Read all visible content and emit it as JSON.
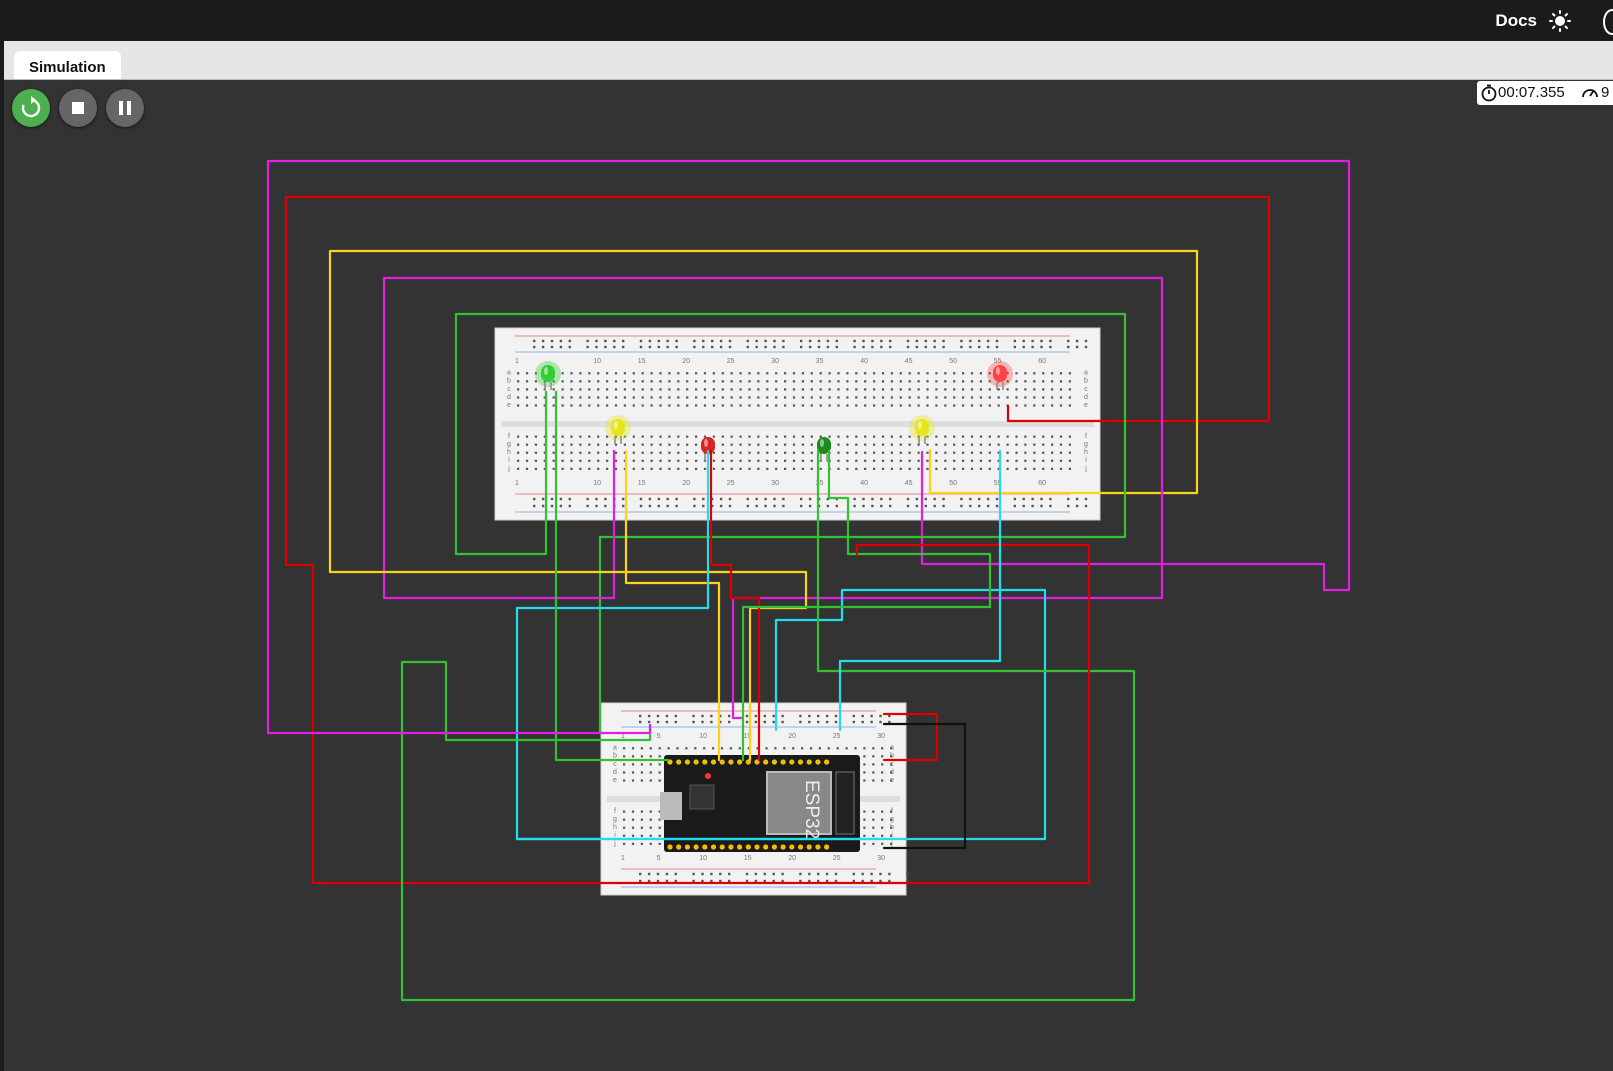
{
  "header": {
    "docs_label": "Docs",
    "theme_icon": "sun-icon"
  },
  "tabs": [
    {
      "label": "Simulation",
      "active": true
    }
  ],
  "toolbar": {
    "restart_icon": "restart-icon",
    "stop_icon": "stop-icon",
    "pause_icon": "pause-icon",
    "restart_color": "#4caf50",
    "button_color": "#666666"
  },
  "status": {
    "clock_icon": "stopwatch-icon",
    "elapsed_time": "00:07.355",
    "speed_icon": "speedometer-icon",
    "speed_value": "9"
  },
  "circuit": {
    "main_breadboard": {
      "column_numbers": [
        "1",
        "10",
        "15",
        "20",
        "25",
        "30",
        "35",
        "40",
        "45",
        "50",
        "55",
        "60"
      ],
      "row_letters_top": [
        "a",
        "b",
        "c",
        "d",
        "e"
      ],
      "row_letters_bottom": [
        "f",
        "g",
        "h",
        "i",
        "j"
      ]
    },
    "small_breadboard": {
      "column_numbers": [
        "1",
        "5",
        "10",
        "15",
        "20",
        "25",
        "30"
      ],
      "row_letters_top": [
        "a",
        "b",
        "c",
        "d",
        "e"
      ],
      "row_letters_bottom": [
        "f",
        "g",
        "h",
        "i",
        "j"
      ]
    },
    "microcontroller_label": "ESP32",
    "leds": [
      {
        "name": "led-green-1",
        "color": "#33cc33",
        "lit": true
      },
      {
        "name": "led-yellow-1",
        "color": "#e6e61a",
        "lit": true
      },
      {
        "name": "led-red-1",
        "color": "#dd2222",
        "lit": false
      },
      {
        "name": "led-green-2",
        "color": "#1f8a1f",
        "lit": false
      },
      {
        "name": "led-yellow-2",
        "color": "#e6e61a",
        "lit": true
      },
      {
        "name": "led-red-2",
        "color": "#ff4444",
        "lit": true
      }
    ],
    "wire_colors": {
      "magenta": "#e020e0",
      "red": "#dd0000",
      "yellow": "#ffd21a",
      "green": "#33c033",
      "cyan": "#22ddee",
      "black": "#111111"
    }
  }
}
